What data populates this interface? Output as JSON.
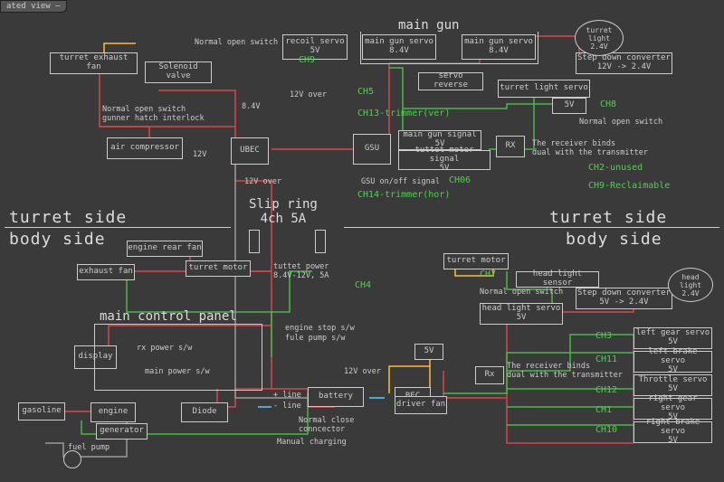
{
  "tab": "ated view —",
  "sections": {
    "turret_side_l": "turret side",
    "body_side_l": "body side",
    "turret_side_r": "turret side",
    "body_side_r": "body side",
    "main_gun": "main gun",
    "slip_ring": "Slip ring\n4ch 5A",
    "main_control_panel": "main control panel"
  },
  "boxes": {
    "turret_exhaust_fan": "turret exhaust fan",
    "solenoid_valve": "Solenoid valve",
    "air_compressor": "air compressor",
    "ubec": "UBEC",
    "recoil_servo": "recoil servo\n5V",
    "main_gun_servo_1": "main gun servo\n8.4V",
    "main_gun_servo_2": "main gun servo\n8.4V",
    "gsu": "GSU",
    "mgsig": "main gun signal\n5V",
    "tuttet_moter_sig": "tuttet moter signal\n5V",
    "rx_t": "RX",
    "servo_reverse": "servo reverse",
    "turret_light_servo": "turret light servo",
    "five_v_t": "5V",
    "step_down_t": "Step down converter\n12V -> 2.4V",
    "turret_light": "turret\nlight\n2.4V",
    "engine_rear_fan": "engine rear fan",
    "exhaust_fan": "exhaust fan",
    "turret_motor_l": "turret motor",
    "turret_motor_r": "turret motor",
    "display": "display",
    "engine": "engine",
    "generator": "generator",
    "diode": "Diode",
    "gasoline": "gasoline",
    "fuel_pump": "fuel pump",
    "battery": "battery",
    "bec": "BEC",
    "five_v_b": "5V",
    "driver_fan": "driver fan",
    "rx_b": "Rx",
    "head_light_sensor": "head light sensor",
    "head_light_servo": "head light servo\n5V",
    "step_down_b": "Step down converter\n5V -> 2.4V",
    "head_light": "head\nlight\n2.4V",
    "left_gear_servo": "left gear servo\n5V",
    "left_brake_servo": "left brake servo\n5V",
    "throttle_servo": "Throttle servo\n5V",
    "right_gear_servo": "right gear servo\n5V",
    "right_brake_servo": "right brake servo\n5V"
  },
  "notes": {
    "normal_open_switch_1": "Normal open switch",
    "nos_gunner": "Normal open switch\ngunner hatch interlock",
    "twelve_v_1": "12V",
    "twelve_v_over_1": "12V over",
    "twelve_v_over_2": "12V over",
    "eight4v": "8.4V",
    "gsu_onoff": "GSU on/off signal",
    "rx_bind_t": "The receiver binds\ndual with the transmitter",
    "rx_bind_b": "The receiver binds\ndual with the transmitter",
    "nos_t_right": "Normal open switch",
    "nos_b_mid": "Normal open switch",
    "main_power_sw": "main power s/w",
    "rx_power_sw": "rx power s/w",
    "engine_stop_sw": "engine stop s/w",
    "fule_pump_sw": "fule pump s/w",
    "plus_line": "+ line",
    "minus_line": "- line",
    "normal_close_conn": "Normal close\nconncector",
    "manual_charging": "Manual charging",
    "twelve_v_over_3": "12V over",
    "tuttet_power": "tuttet power\n8.4V-12V, 5A"
  },
  "channels": {
    "ch9": "CH9",
    "ch5": "CH5",
    "ch13": "CH13-trimmer(ver)",
    "ch06": "CH06",
    "ch14": "CH14-trimmer(hor)",
    "ch8": "CH8",
    "ch2u": "CH2-unused",
    "ch9r": "CH9-Reclaimable",
    "ch4": "CH4",
    "ch7": "CH7",
    "ch3": "CH3",
    "ch11": "CH11",
    "ch12": "CH12",
    "ch1": "CH1",
    "ch10": "CH10"
  }
}
